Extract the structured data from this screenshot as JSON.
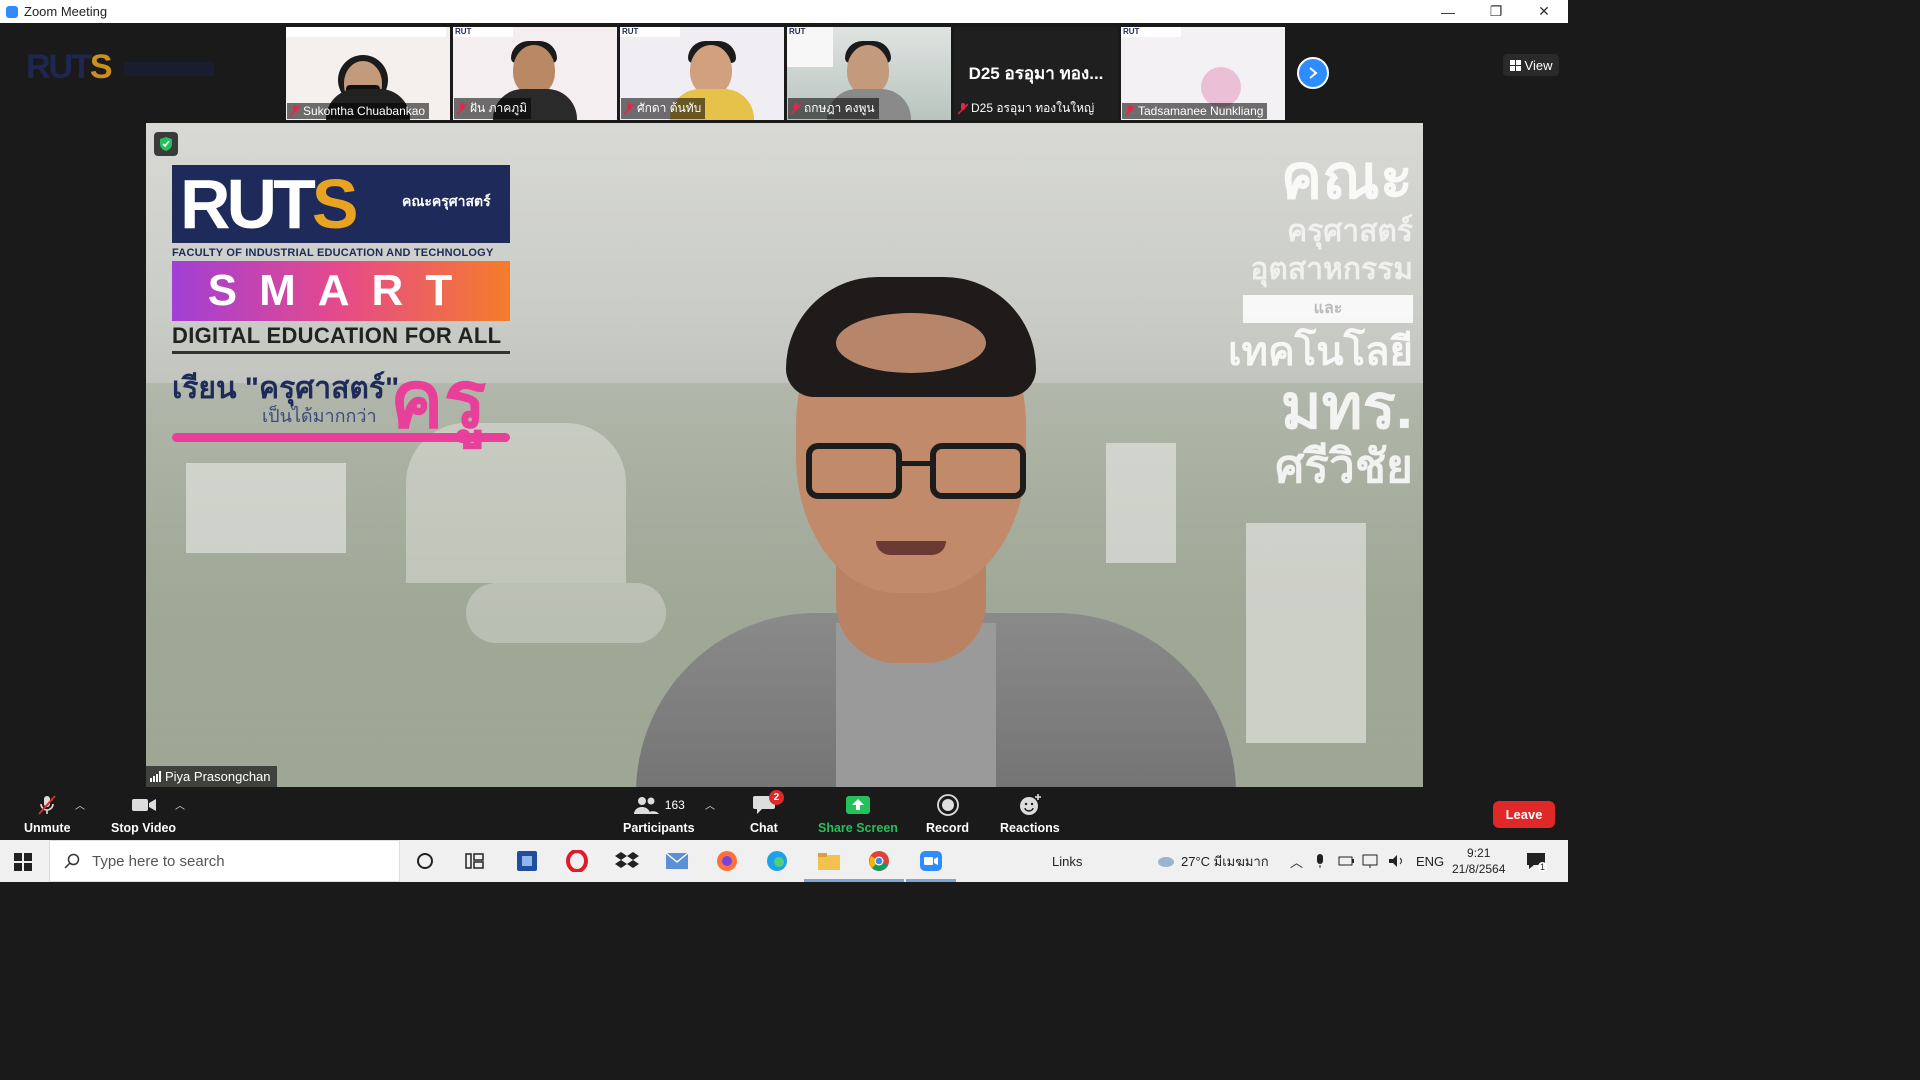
{
  "window": {
    "title": "Zoom Meeting",
    "minimize": "—",
    "restore": "❐",
    "close": "✕"
  },
  "logo": {
    "part1": "RUT",
    "part2": "S"
  },
  "view_button": "View",
  "thumbnails": [
    {
      "name": "Sukontha Chuabankao",
      "shirt_color": "#222222",
      "bg": "#f3f0ee"
    },
    {
      "name": "ฝัน ภาคภูมิ",
      "shirt_color": "#2a2a2a",
      "bg": "#f4eef0"
    },
    {
      "name": "ศักดา ต้นทับ",
      "shirt_color": "#e6c24a",
      "bg": "#f1eef3"
    },
    {
      "name": "ถกษฎา คงพูน",
      "shirt_color": "#8a8a8a",
      "bg": "#c9d3cf"
    },
    {
      "name": "D25 อรอุมา ทองในใหญ่",
      "big_label": "D25 อรอุมา ทอง...",
      "video_off": true
    },
    {
      "name": "Tadsamanee Nunkliang",
      "bg": "#f4f1f4"
    }
  ],
  "thumb_top_label": "RUT",
  "main": {
    "speaker_name": "Piya Prasongchan",
    "brand": {
      "ruts_a": "RUT",
      "ruts_b": "S",
      "faculty_thai": "คณะครุศาสตร์",
      "faculty_en": "FACULTY OF INDUSTRIAL EDUCATION AND TECHNOLOGY",
      "smart": "SMART",
      "tagline": "DIGITAL EDUCATION FOR ALL",
      "study_line": "เรียน \"ครุศาสตร์\"",
      "more_line": "เป็นได้มากกว่า",
      "kru": "ครู"
    },
    "right_thai": [
      "คณะ",
      "ครุศาสตร์",
      "อุตสาหกรรม",
      "และ",
      "เทคโนโลยี",
      "มทร.",
      "ศรีวิชัย"
    ]
  },
  "toolbar": {
    "unmute": "Unmute",
    "stop_video": "Stop Video",
    "participants": "Participants",
    "participants_count": "163",
    "chat": "Chat",
    "chat_badge": "2",
    "share_screen": "Share Screen",
    "record": "Record",
    "reactions": "Reactions",
    "leave": "Leave"
  },
  "colors": {
    "accent": "#2d8cff",
    "share_green": "#24c05a",
    "leave_red": "#e02828"
  },
  "taskbar": {
    "search_placeholder": "Type here to search",
    "links": "Links",
    "weather": "27°C มีเมฆมาก",
    "lang": "ENG",
    "time": "9:21",
    "date": "21/8/2564",
    "notif_count": "1"
  }
}
